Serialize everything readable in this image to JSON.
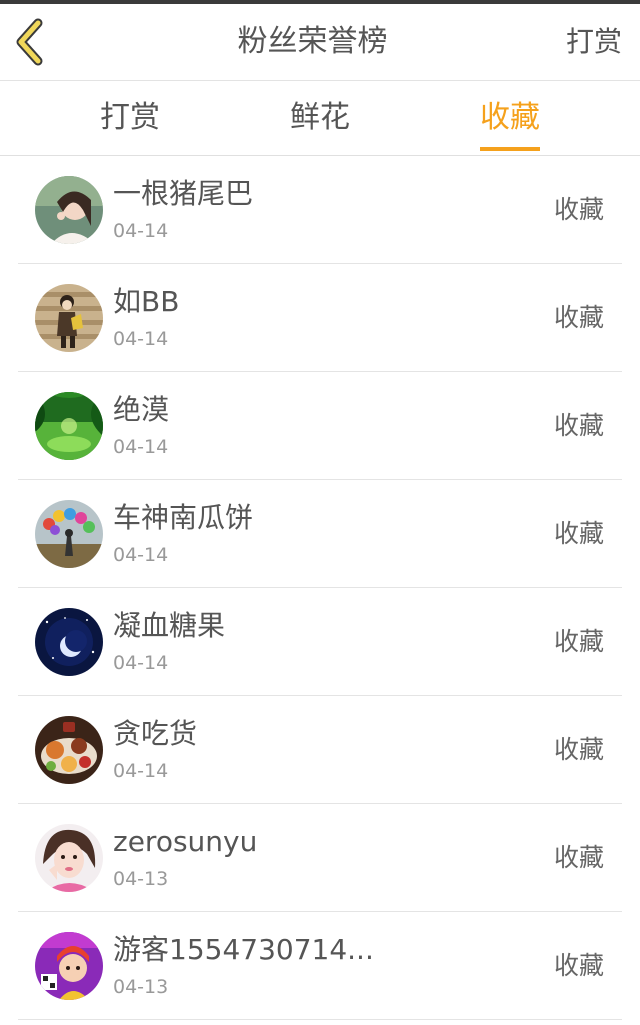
{
  "header": {
    "title": "粉丝荣誉榜",
    "right_action": "打赏"
  },
  "tabs": [
    {
      "label": "打赏",
      "active": false
    },
    {
      "label": "鲜花",
      "active": false
    },
    {
      "label": "收藏",
      "active": true
    }
  ],
  "colors": {
    "accent": "#f5a11c",
    "text_primary": "#555555",
    "text_secondary": "#999999",
    "divider": "#e4e4e4"
  },
  "items": [
    {
      "name": "一根猪尾巴",
      "date": "04-14",
      "action": "收藏",
      "avatar": "avatar-girl-photo"
    },
    {
      "name": "如BB",
      "date": "04-14",
      "action": "收藏",
      "avatar": "avatar-anime-couple"
    },
    {
      "name": "绝漠",
      "date": "04-14",
      "action": "收藏",
      "avatar": "avatar-green-forest"
    },
    {
      "name": "车神南瓜饼",
      "date": "04-14",
      "action": "收藏",
      "avatar": "avatar-balloons"
    },
    {
      "name": "凝血糖果",
      "date": "04-14",
      "action": "收藏",
      "avatar": "avatar-moon-night"
    },
    {
      "name": "贪吃货",
      "date": "04-14",
      "action": "收藏",
      "avatar": "avatar-food"
    },
    {
      "name": "zerosunyu",
      "date": "04-13",
      "action": "收藏",
      "avatar": "avatar-girl-selfie"
    },
    {
      "name": "游客1554730714...",
      "date": "04-13",
      "action": "收藏",
      "avatar": "avatar-cartoon-purple"
    }
  ]
}
